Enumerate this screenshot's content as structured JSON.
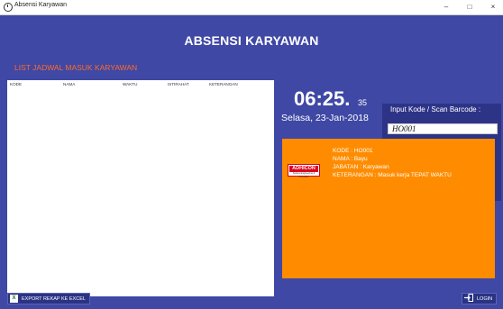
{
  "window": {
    "title": "Absensi Karyawan",
    "minimize_glyph": "–",
    "maximize_glyph": "□",
    "close_glyph": "×"
  },
  "heading": "ABSENSI KARYAWAN",
  "schedule": {
    "title": "LIST JADWAL MASUK KARYAWAN",
    "columns": [
      "KODE",
      "NAMA",
      "WAKTU",
      "ISTIRAHAT",
      "KETERANGAN"
    ],
    "rows": []
  },
  "clock": {
    "time": "06:25.",
    "seconds": "35",
    "date": "Selasa, 23-Jan-2018"
  },
  "scan": {
    "label": "Input Kode / Scan Barcode :",
    "value": "HO001"
  },
  "info": {
    "logo_top": "ADHICON",
    "logo_bottom": "Sukses Engineering & Komputer",
    "kode": "KODE : HO001",
    "nama": "NAMA : Bayu",
    "jabatan": "JABATAN : Karyawan",
    "keterangan": "KETERANGAN : Masuk kerja TEPAT WAKTU"
  },
  "footer": {
    "export_label": "EXPORT REKAP KE EXCEL",
    "login_label": "LOGIN"
  },
  "colors": {
    "background": "#3f48a4",
    "accent_orange": "#ff8c00",
    "title_orange": "#ff6a2c",
    "input_panel": "#2d3487"
  },
  "icons": [
    "app-clock-icon",
    "excel-icon",
    "login-icon"
  ]
}
